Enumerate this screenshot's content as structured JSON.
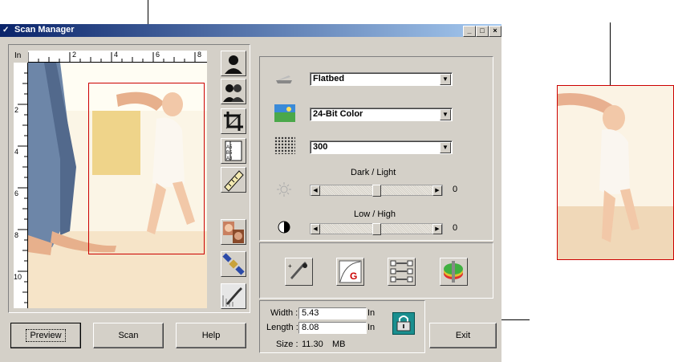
{
  "window": {
    "title": "Scan Manager",
    "min_glyph": "_",
    "max_glyph": "□",
    "close_glyph": "×"
  },
  "ruler": {
    "unit": "In",
    "h_ticks": [
      "2",
      "4",
      "6",
      "8"
    ],
    "v_ticks": [
      "2",
      "4",
      "6",
      "8",
      "10"
    ]
  },
  "settings": {
    "source": "Flatbed",
    "color_mode": "24-Bit Color",
    "resolution": "300",
    "brightness_label": "Dark / Light",
    "brightness_value": "0",
    "brightness_level": 0.5,
    "contrast_label": "Low / High",
    "contrast_value": "0",
    "contrast_level": 0.5
  },
  "size": {
    "width_label": "Width :",
    "width_value": "5.43",
    "width_unit": "In",
    "length_label": "Length :",
    "length_value": "8.08",
    "length_unit": "In",
    "size_label": "Size :",
    "size_value": "11.30",
    "size_unit": "MB"
  },
  "buttons": {
    "preview": "Preview",
    "scan": "Scan",
    "help": "Help",
    "exit": "Exit"
  },
  "icons": {
    "tools": [
      "portrait-icon",
      "group-icon",
      "crop-icon",
      "paper-size-icon",
      "ruler-icon",
      "faces-icon",
      "satellite-icon",
      "eyedropper-icon"
    ],
    "adjust": [
      "color-picker-icon",
      "gamma-curve-icon",
      "color-balance-icon",
      "color-wheel-icon"
    ]
  },
  "colors": {
    "frame_accent": "#cc0000",
    "title_start": "#0a246a",
    "title_end": "#a6caf0"
  }
}
